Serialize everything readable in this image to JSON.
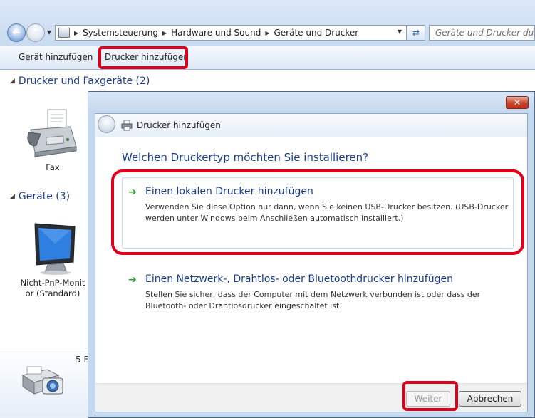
{
  "explorer": {
    "breadcrumbs": [
      "Systemsteuerung",
      "Hardware und Sound",
      "Geräte und Drucker"
    ],
    "search_placeholder": "Geräte und Drucker durchsuchen",
    "toolbar": {
      "add_device": "Gerät hinzufügen",
      "add_printer": "Drucker hinzufügen"
    },
    "groups": [
      {
        "label": "Drucker und Faxgeräte (2)"
      },
      {
        "label": "Geräte (3)"
      }
    ],
    "devices": {
      "fax_label": "Fax",
      "monitor_label_line1": "Nicht-PnP-Monit",
      "monitor_label_line2": "or (Standard)"
    },
    "details_count": "5 E"
  },
  "dialog": {
    "title": "Drucker hinzufügen",
    "question": "Welchen Druckertyp möchten Sie installieren?",
    "options": [
      {
        "title": "Einen lokalen Drucker hinzufügen",
        "description": "Verwenden Sie diese Option nur dann, wenn Sie keinen USB-Drucker besitzen. (USB-Drucker werden unter Windows beim Anschließen automatisch installiert.)"
      },
      {
        "title": "Einen Netzwerk-, Drahtlos- oder Bluetoothdrucker hinzufügen",
        "description": "Stellen Sie sicher, dass der Computer mit dem Netzwerk verbunden ist oder dass der Bluetooth- oder Drahtlosdrucker eingeschaltet ist."
      }
    ],
    "buttons": {
      "next": "Weiter",
      "cancel": "Abbrechen"
    }
  },
  "colors": {
    "highlight": "#e0001a",
    "link_blue": "#1a3e8c",
    "arrow_green": "#2f9e2f"
  }
}
